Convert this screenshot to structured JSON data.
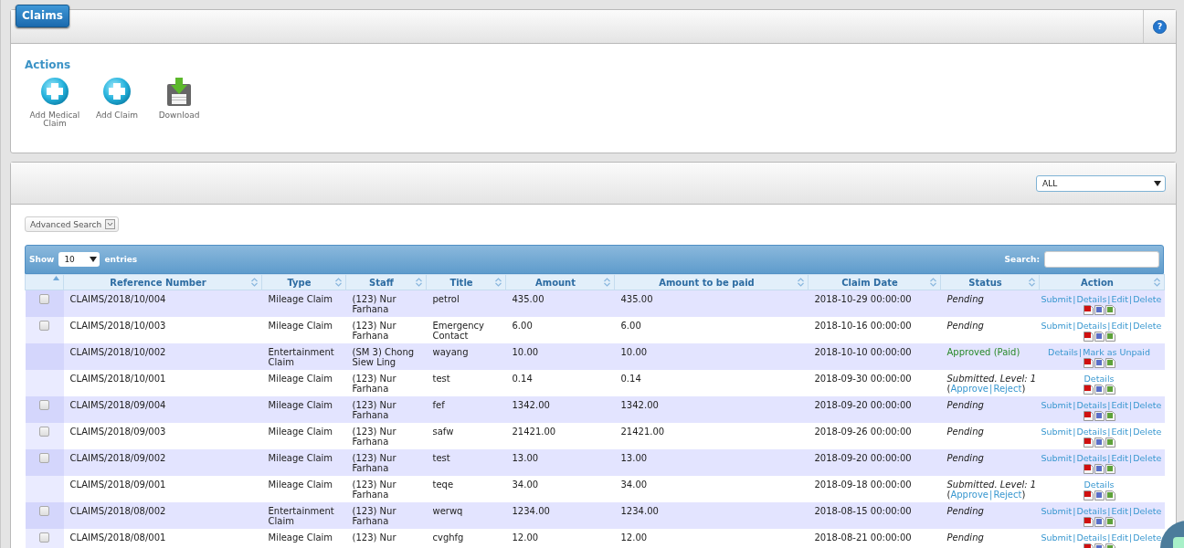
{
  "page_tab": "Claims",
  "help": "?",
  "actions": {
    "title": "Actions",
    "items": [
      {
        "kind": "add",
        "label": "Add Medical Claim"
      },
      {
        "kind": "add",
        "label": "Add Claim"
      },
      {
        "kind": "download",
        "label": "Download"
      }
    ]
  },
  "filter": {
    "value": "ALL"
  },
  "advanced_search": "Advanced Search",
  "table": {
    "show_label": "Show",
    "page_size": "10",
    "entries_label": "entries",
    "search_label": "Search:",
    "link_separator": "|",
    "columns": [
      {
        "sorted": true
      },
      {
        "label": "Reference Number",
        "sorted": false
      },
      {
        "label": "Type",
        "sorted": false
      },
      {
        "label": "Staff",
        "sorted": false
      },
      {
        "label": "Title",
        "sorted": false
      },
      {
        "label": "Amount",
        "sorted": false
      },
      {
        "label": "Amount to be paid",
        "sorted": false
      },
      {
        "label": "Claim Date",
        "sorted": false
      },
      {
        "label": "Status",
        "sorted": false
      },
      {
        "label": "Action",
        "sorted": false
      }
    ],
    "rows": [
      {
        "checked": false,
        "ref": "CLAIMS/2018/10/004",
        "type": "Mileage Claim",
        "staff": "(123) Nur Farhana",
        "title": "petrol",
        "amount": "435.00",
        "to_pay": "435.00",
        "date": "2018-10-29 00:00:00",
        "status": {
          "kind": "pending",
          "text": "Pending"
        },
        "actions": [
          "Submit",
          "Details",
          "Edit",
          "Delete"
        ]
      },
      {
        "checked": false,
        "ref": "CLAIMS/2018/10/003",
        "type": "Mileage Claim",
        "staff": "(123) Nur Farhana",
        "title": "Emergency Contact",
        "amount": "6.00",
        "to_pay": "6.00",
        "date": "2018-10-16 00:00:00",
        "status": {
          "kind": "pending",
          "text": "Pending"
        },
        "actions": [
          "Submit",
          "Details",
          "Edit",
          "Delete"
        ]
      },
      {
        "ref": "CLAIMS/2018/10/002",
        "type": "Entertainment Claim",
        "staff": "(SM 3) Chong Siew Ling",
        "title": "wayang",
        "amount": "10.00",
        "to_pay": "10.00",
        "date": "2018-10-10 00:00:00",
        "status": {
          "kind": "approved",
          "text": "Approved (Paid)"
        },
        "actions": [
          "Details",
          "Mark as Unpaid"
        ]
      },
      {
        "ref": "CLAIMS/2018/10/001",
        "type": "Mileage Claim",
        "staff": "(123) Nur Farhana",
        "title": "test",
        "amount": "0.14",
        "to_pay": "0.14",
        "date": "2018-09-30 00:00:00",
        "status": {
          "kind": "submitted",
          "text": "Submitted. Level: 1",
          "prefix": "(",
          "links": [
            "Approve",
            "Reject"
          ],
          "suffix": ")"
        },
        "actions": [
          "Details"
        ]
      },
      {
        "checked": false,
        "ref": "CLAIMS/2018/09/004",
        "type": "Mileage Claim",
        "staff": "(123) Nur Farhana",
        "title": "fef",
        "amount": "1342.00",
        "to_pay": "1342.00",
        "date": "2018-09-20 00:00:00",
        "status": {
          "kind": "pending",
          "text": "Pending"
        },
        "actions": [
          "Submit",
          "Details",
          "Edit",
          "Delete"
        ]
      },
      {
        "checked": false,
        "ref": "CLAIMS/2018/09/003",
        "type": "Mileage Claim",
        "staff": "(123) Nur Farhana",
        "title": "safw",
        "amount": "21421.00",
        "to_pay": "21421.00",
        "date": "2018-09-26 00:00:00",
        "status": {
          "kind": "pending",
          "text": "Pending"
        },
        "actions": [
          "Submit",
          "Details",
          "Edit",
          "Delete"
        ]
      },
      {
        "checked": false,
        "ref": "CLAIMS/2018/09/002",
        "type": "Mileage Claim",
        "staff": "(123) Nur Farhana",
        "title": "test",
        "amount": "13.00",
        "to_pay": "13.00",
        "date": "2018-09-20 00:00:00",
        "status": {
          "kind": "pending",
          "text": "Pending"
        },
        "actions": [
          "Submit",
          "Details",
          "Edit",
          "Delete"
        ]
      },
      {
        "ref": "CLAIMS/2018/09/001",
        "type": "Mileage Claim",
        "staff": "(123) Nur Farhana",
        "title": "teqe",
        "amount": "34.00",
        "to_pay": "34.00",
        "date": "2018-09-18 00:00:00",
        "status": {
          "kind": "submitted",
          "text": "Submitted. Level: 1",
          "prefix": "(",
          "links": [
            "Approve",
            "Reject"
          ],
          "suffix": ")"
        },
        "actions": [
          "Details"
        ]
      },
      {
        "checked": false,
        "ref": "CLAIMS/2018/08/002",
        "type": "Entertainment Claim",
        "staff": "(123) Nur Farhana",
        "title": "werwq",
        "amount": "1234.00",
        "to_pay": "1234.00",
        "date": "2018-08-15 00:00:00",
        "status": {
          "kind": "pending",
          "text": "Pending"
        },
        "actions": [
          "Submit",
          "Details",
          "Edit",
          "Delete"
        ]
      },
      {
        "checked": false,
        "ref": "CLAIMS/2018/08/001",
        "type": "Mileage Claim",
        "staff": "(123) Nur",
        "title": "cvghfg",
        "amount": "12.00",
        "to_pay": "12.00",
        "date": "2018-08-21 00:00:00",
        "status": {
          "kind": "pending",
          "text": "Pending"
        },
        "actions": [
          "Submit",
          "Details",
          "Edit",
          "Delete"
        ]
      }
    ]
  }
}
